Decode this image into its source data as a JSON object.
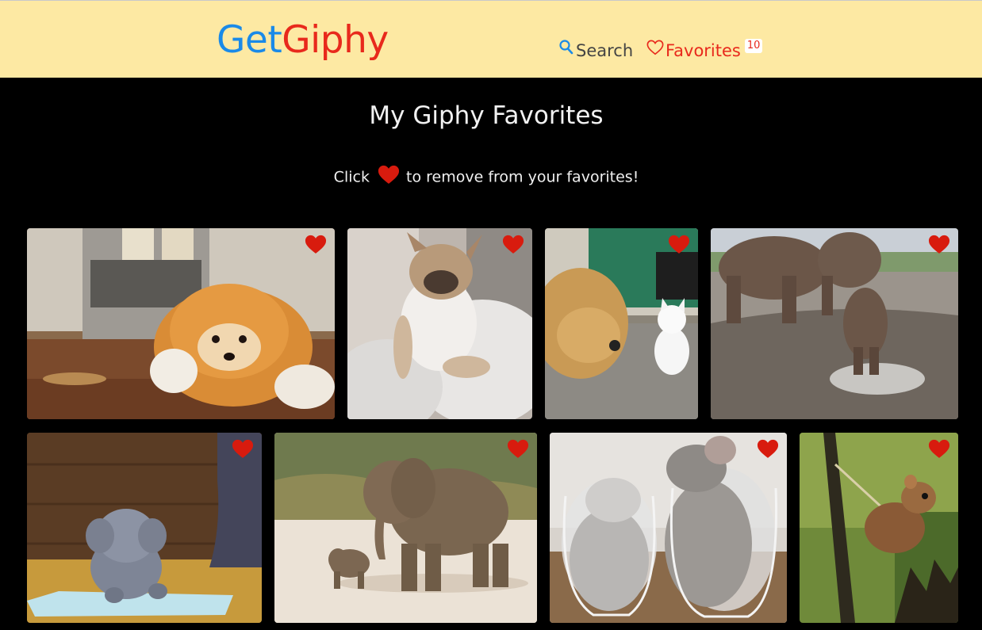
{
  "header": {
    "logo_part1": "Get",
    "logo_part2": "Giphy",
    "nav": {
      "search_label": "Search",
      "search_icon": "search-icon",
      "favorites_label": "Favorites",
      "favorites_icon": "heart-outline-icon",
      "favorites_count": "10"
    }
  },
  "main": {
    "title": "My Giphy Favorites",
    "hint_prefix": "Click",
    "hint_suffix": "to remove from your favorites!",
    "hint_icon": "heart-icon"
  },
  "colors": {
    "header_bg": "#fde9a3",
    "logo_blue": "#1a8ae8",
    "accent_red": "#e8291c",
    "page_bg": "#000000"
  },
  "gifs": [
    {
      "subject": "fluffy pomeranian puppy",
      "favorited": true
    },
    {
      "subject": "french bulldog sleeping on couch",
      "favorited": true
    },
    {
      "subject": "golden retriever and white kitten",
      "favorited": true
    },
    {
      "subject": "elephants walking in water",
      "favorited": true
    },
    {
      "subject": "cartoon baby elephant",
      "favorited": true
    },
    {
      "subject": "elephant with baby",
      "favorited": true
    },
    {
      "subject": "chinchillas in wine glasses",
      "favorited": true
    },
    {
      "subject": "harvest mouse on thistle",
      "favorited": true
    }
  ]
}
